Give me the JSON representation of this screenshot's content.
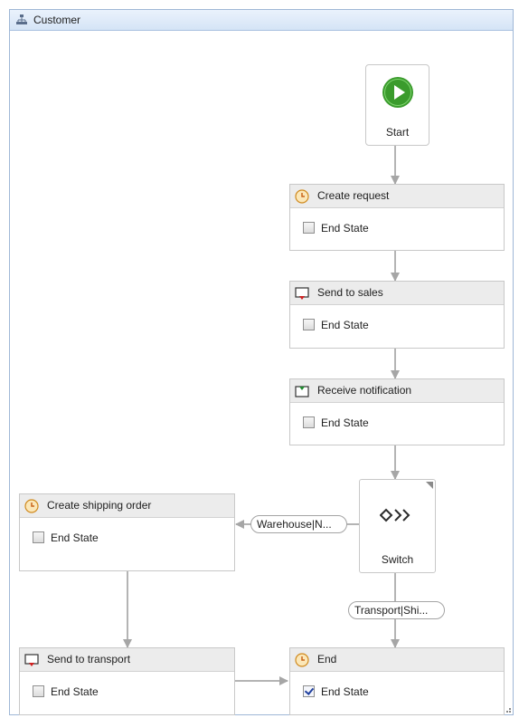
{
  "designer": {
    "title": "Customer",
    "title_icon": "workflow-hierarchy-icon",
    "start": {
      "label": "Start",
      "icon": "start-play-icon",
      "color": "#3a9b2c"
    },
    "switch": {
      "label": "Switch",
      "icon": "switch-diamond-arrows-icon"
    },
    "states": [
      {
        "title": "Create request",
        "icon": "clock-state-icon",
        "end_state_label": "End State",
        "end_state_checked": false
      },
      {
        "title": "Send to sales",
        "icon": "send-message-icon",
        "end_state_label": "End State",
        "end_state_checked": false
      },
      {
        "title": "Receive notification",
        "icon": "receive-message-icon",
        "end_state_label": "End State",
        "end_state_checked": false
      },
      {
        "title": "Create shipping order",
        "icon": "clock-state-icon",
        "end_state_label": "End State",
        "end_state_checked": false
      },
      {
        "title": "Send to transport",
        "icon": "send-message-icon",
        "end_state_label": "End State",
        "end_state_checked": false
      },
      {
        "title": "End",
        "icon": "clock-state-icon",
        "end_state_label": "End State",
        "end_state_checked": true
      }
    ],
    "conditions": [
      {
        "label": "Warehouse|N..."
      },
      {
        "label": "Transport|Shi..."
      }
    ]
  }
}
